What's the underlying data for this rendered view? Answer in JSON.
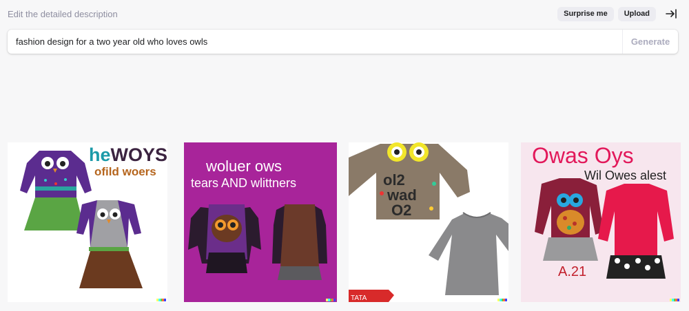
{
  "header": {
    "hint": "Edit the detailed description",
    "surprise_label": "Surprise me",
    "upload_label": "Upload"
  },
  "prompt": {
    "value": "fashion design for a two year old who loves owls",
    "generate_label": "Generate"
  },
  "images": [
    {
      "lines": [
        "heWOYS",
        "ofild woers"
      ],
      "colors": [
        "#1b9aa8",
        "#3b2340",
        "#b5651d"
      ]
    },
    {
      "lines": [
        "woluer ows",
        "tears AND wlittners"
      ],
      "colors": [
        "#ffffff"
      ]
    },
    {
      "lines": [
        "ol2",
        "wad",
        "O2",
        "TATA"
      ],
      "colors": [
        "#2b2b2b",
        "#ffffff"
      ]
    },
    {
      "lines": [
        "Owas Oys",
        "Wil Owes alest",
        "A.21"
      ],
      "colors": [
        "#e2185a",
        "#222222",
        "#c21f2b"
      ]
    }
  ],
  "signature_colors": [
    "#ffff66",
    "#42ffff",
    "#51da4c",
    "#ff6e3c",
    "#3c46ff"
  ]
}
